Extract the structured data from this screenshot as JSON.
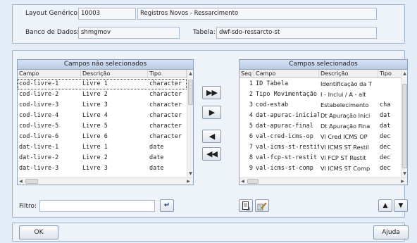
{
  "header": {
    "layout_label": "Layout Genérico:",
    "layout_code": "10003",
    "layout_desc": "Registros Novos - Ressarcimento",
    "db_label": "Banco de Dados:",
    "db_value": "shmgmov",
    "table_label": "Tabela:",
    "table_value": "dwf-sdo-ressarcto-st"
  },
  "left_list": {
    "title": "Campos não selecionados",
    "columns": [
      "Campo",
      "Descrição",
      "Tipo"
    ],
    "rows": [
      [
        "cod-livre-1",
        "Livre 1",
        "character"
      ],
      [
        "cod-livre-2",
        "Livre 2",
        "character"
      ],
      [
        "cod-livre-3",
        "Livre 3",
        "character"
      ],
      [
        "cod-livre-4",
        "Livre 4",
        "character"
      ],
      [
        "cod-livre-5",
        "Livre 5",
        "character"
      ],
      [
        "cod-livre-6",
        "Livre 6",
        "character"
      ],
      [
        "dat-livre-1",
        "Livre 1",
        "date"
      ],
      [
        "dat-livre-2",
        "Livre 2",
        "date"
      ],
      [
        "dat-livre-3",
        "Livre 3",
        "date"
      ]
    ]
  },
  "right_list": {
    "title": "Campos selecionados",
    "columns": [
      "Seq",
      "Campo",
      "Descrição",
      "Tipo"
    ],
    "rows": [
      [
        "1",
        "ID Tabela",
        "Identificação da T",
        ""
      ],
      [
        "2",
        "Tipo Movimentação",
        "I - Inclui / A - alt",
        ""
      ],
      [
        "3",
        "cod-estab",
        "Estabelecimento",
        "cha"
      ],
      [
        "4",
        "dat-apurac-inicial",
        "Dt Apuração Inici",
        "dat"
      ],
      [
        "5",
        "dat-apurac-final",
        "Dt Apuração Fina",
        "dat"
      ],
      [
        "6",
        "val-cred-icms-op",
        "Vl Cred ICMS OP",
        "dec"
      ],
      [
        "7",
        "val-icms-st-restit",
        "Vl ICMS ST Restil",
        "dec"
      ],
      [
        "8",
        "val-fcp-st-restit",
        "Vl FCP ST Restit",
        "dec"
      ],
      [
        "9",
        "val-icms-st-comp",
        "Vl ICMS ST Comp",
        "dec"
      ]
    ]
  },
  "move_buttons": {
    "add_all": "▶▶",
    "add": "▶",
    "remove": "◀",
    "remove_all": "◀◀"
  },
  "filter": {
    "label": "Filtro:",
    "value": ""
  },
  "icons": {
    "filter_apply": "enter-arrow-icon",
    "document": "document-icon",
    "edit": "edit-pencil-icon",
    "up": "triangle-up-icon",
    "down": "triangle-down-icon"
  },
  "footer": {
    "ok_label": "OK",
    "help_label": "Ajuda"
  }
}
